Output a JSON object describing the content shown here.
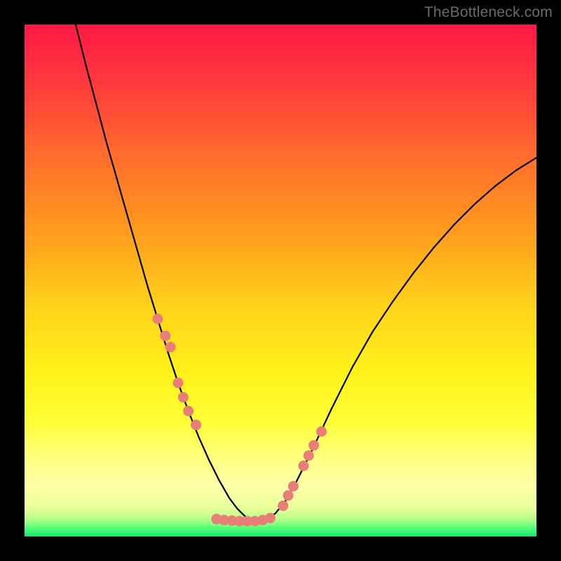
{
  "watermark": "TheBottleneck.com",
  "chart_data": {
    "type": "line",
    "title": "",
    "xlabel": "",
    "ylabel": "",
    "xlim": [
      0,
      100
    ],
    "ylim": [
      0,
      100
    ],
    "background_gradient": {
      "stops": [
        {
          "offset": 0.0,
          "color": "#ff1846"
        },
        {
          "offset": 0.12,
          "color": "#ff3b3d"
        },
        {
          "offset": 0.25,
          "color": "#ff6a2d"
        },
        {
          "offset": 0.4,
          "color": "#ff9a1e"
        },
        {
          "offset": 0.55,
          "color": "#ffd21a"
        },
        {
          "offset": 0.68,
          "color": "#fff21a"
        },
        {
          "offset": 0.78,
          "color": "#ffff3a"
        },
        {
          "offset": 0.84,
          "color": "#ffff7a"
        },
        {
          "offset": 0.905,
          "color": "#ffffaa"
        },
        {
          "offset": 0.945,
          "color": "#e8ff9a"
        },
        {
          "offset": 0.965,
          "color": "#b8ff8a"
        },
        {
          "offset": 0.985,
          "color": "#4fff7a"
        },
        {
          "offset": 1.0,
          "color": "#18e868"
        }
      ]
    },
    "series": [
      {
        "name": "bottleneck-curve",
        "color": "#000000",
        "width": 2.2,
        "x": [
          10.0,
          12.0,
          14.0,
          16.0,
          18.0,
          20.0,
          22.0,
          24.0,
          26.0,
          28.0,
          30.0,
          32.0,
          34.0,
          36.0,
          38.0,
          40.0,
          41.5,
          43.0,
          45.0,
          47.0,
          49.0,
          51.0,
          53.0,
          56.0,
          60.0,
          64.0,
          68.0,
          72.0,
          76.0,
          80.0,
          84.0,
          88.0,
          92.0,
          96.0,
          100.0
        ],
        "y": [
          100.0,
          92.0,
          84.5,
          77.0,
          70.0,
          63.0,
          56.0,
          49.0,
          42.5,
          36.0,
          30.0,
          24.5,
          19.5,
          15.0,
          11.0,
          7.5,
          5.5,
          4.0,
          3.0,
          3.2,
          4.5,
          7.0,
          10.5,
          16.5,
          25.0,
          33.0,
          40.0,
          46.0,
          51.5,
          56.5,
          61.0,
          65.0,
          68.5,
          71.5,
          74.0
        ]
      }
    ],
    "markers": {
      "color": "#e77f77",
      "radius": 7.5,
      "left_arm": {
        "x": [
          26.0,
          27.5,
          28.5,
          30.0,
          31.0,
          32.0,
          33.5
        ],
        "y": [
          42.5,
          39.2,
          37.0,
          30.0,
          27.2,
          24.5,
          21.8
        ]
      },
      "right_arm": {
        "x": [
          50.5,
          51.5,
          52.5,
          54.5,
          55.5,
          56.5,
          58.0
        ],
        "y": [
          6.0,
          8.0,
          9.8,
          13.8,
          15.8,
          17.8,
          20.5
        ]
      },
      "valley": {
        "x": [
          37.5,
          39.0,
          40.5,
          42.0,
          43.5,
          45.0,
          46.5,
          48.0
        ],
        "y": [
          3.4,
          3.2,
          3.1,
          3.0,
          3.0,
          3.0,
          3.2,
          3.6
        ]
      }
    }
  }
}
